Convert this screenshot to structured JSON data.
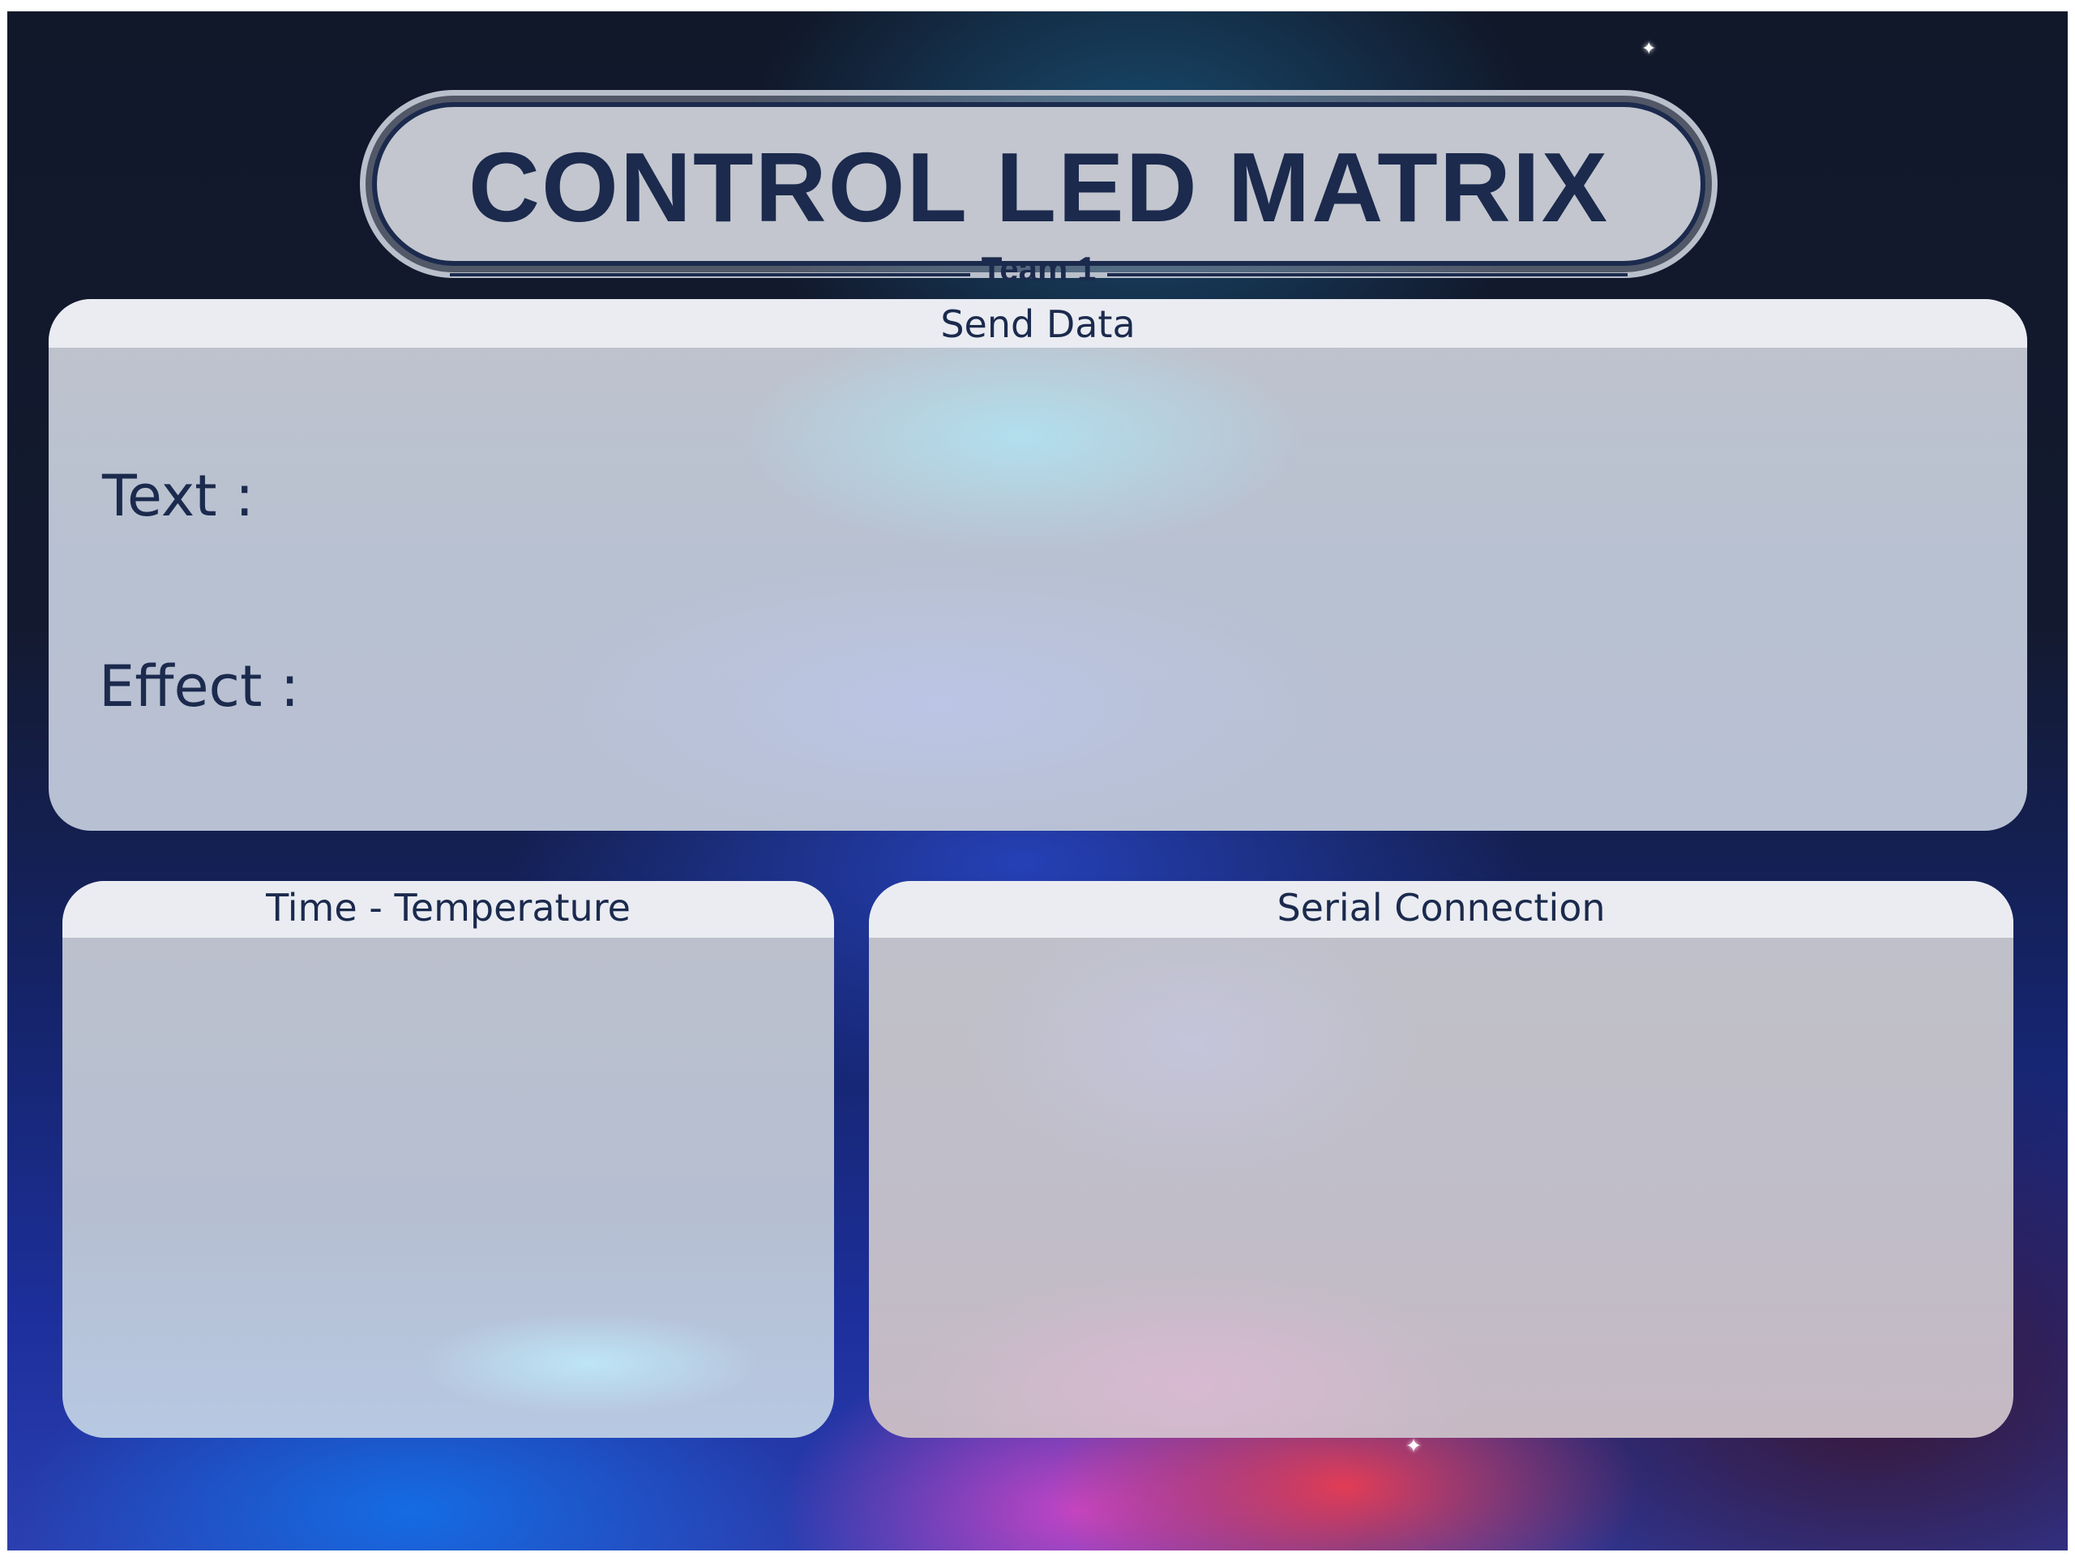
{
  "header": {
    "title": "CONTROL LED MATRIX",
    "subtitle": "Team 1"
  },
  "send_data": {
    "heading": "Send Data",
    "text_label": "Text :",
    "effect_label": "Effect :"
  },
  "time_temperature": {
    "heading": "Time - Temperature"
  },
  "serial_connection": {
    "heading": "Serial Connection"
  },
  "theme": {
    "text_color": "#1b2a4d",
    "panel_color": "#c4c8d2",
    "header_color": "#eceef3",
    "background": "starfield-nebula"
  },
  "decorations": {
    "star_glyph": "✦"
  }
}
